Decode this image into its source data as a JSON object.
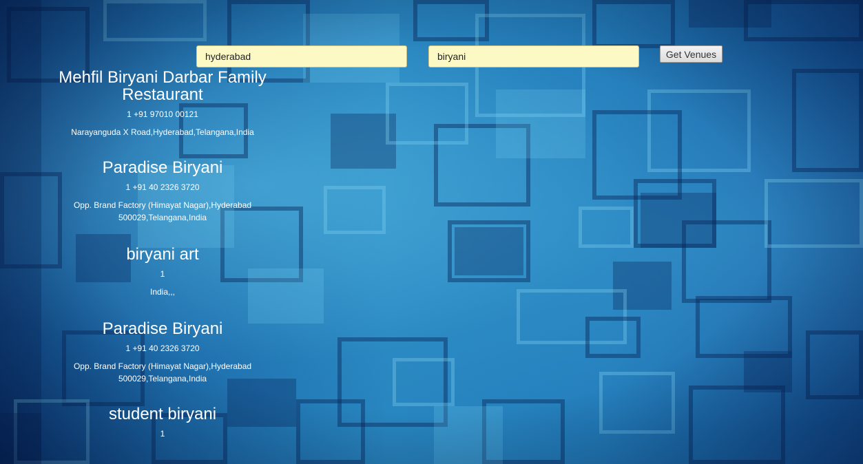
{
  "search": {
    "city_value": "hyderabad",
    "query_value": "biryani",
    "button_label": "Get Venues"
  },
  "venues": [
    {
      "name": "Mehfil Biryani Darbar Family Restaurant",
      "phone": "1 +91 97010 00121",
      "address": "Narayanguda X Road,Hyderabad,Telangana,India"
    },
    {
      "name": "Paradise Biryani",
      "phone": "1 +91 40 2326 3720",
      "address": "Opp. Brand Factory (Himayat Nagar),Hyderabad 500029,Telangana,India"
    },
    {
      "name": "biryani art",
      "phone": "1",
      "address": "India,,,"
    },
    {
      "name": "Paradise Biryani",
      "phone": "1 +91 40 2326 3720",
      "address": "Opp. Brand Factory (Himayat Nagar),Hyderabad 500029,Telangana,India"
    },
    {
      "name": "student biryani",
      "phone": "1",
      "address": ""
    }
  ]
}
